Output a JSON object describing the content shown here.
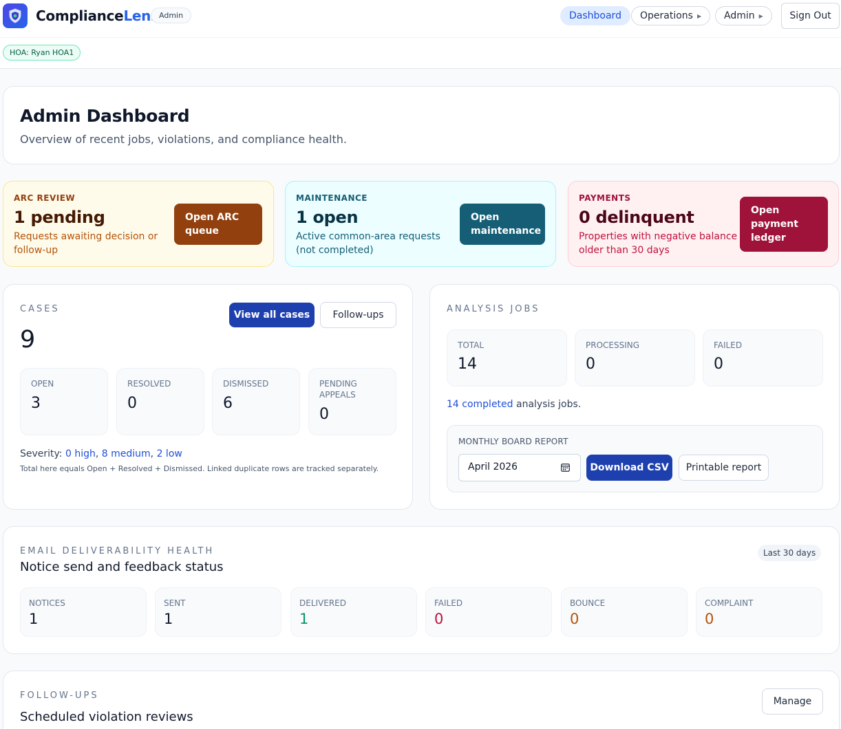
{
  "header": {
    "brand_main": "Compliance",
    "brand_accent": "Lens",
    "role": "Admin",
    "nav": {
      "dashboard": "Dashboard",
      "operations": "Operations",
      "admin": "Admin"
    },
    "sign_out": "Sign Out",
    "hoa": "HOA: Ryan HOA1"
  },
  "page": {
    "title": "Admin Dashboard",
    "subtitle": "Overview of recent jobs, violations, and compliance health."
  },
  "quick": {
    "arc": {
      "label": "ARC REVIEW",
      "value": "1 pending",
      "desc1": "Requests awaiting decision or",
      "desc2": "follow-up",
      "btn1": "Open ARC",
      "btn2": "queue"
    },
    "maintenance": {
      "label": "MAINTENANCE",
      "value": "1 open",
      "desc1": "Active common-area requests",
      "desc2": "(not completed)",
      "btn1": "Open",
      "btn2": "maintenance"
    },
    "payments": {
      "label": "PAYMENTS",
      "value": "0 delinquent",
      "desc1": "Properties with negative balance",
      "desc2": "older than 30 days",
      "btn1": "Open",
      "btn2": "payment",
      "btn3": "ledger"
    }
  },
  "cases": {
    "label": "CASES",
    "total": "9",
    "view_all": "View all cases",
    "follow_ups": "Follow-ups",
    "stats": [
      {
        "label": "OPEN",
        "value": "3"
      },
      {
        "label": "RESOLVED",
        "value": "0"
      },
      {
        "label": "DISMISSED",
        "value": "6"
      },
      {
        "label1": "PENDING",
        "label2": "APPEALS",
        "value": "0"
      }
    ],
    "severity_prefix": "Severity: ",
    "sev_high": "0 high",
    "sev_medium": "8 medium",
    "sev_low": "2 low",
    "sep": ", ",
    "note": "Total here equals Open + Resolved + Dismissed. Linked duplicate rows are tracked separately."
  },
  "jobs": {
    "label": "ANALYSIS JOBS",
    "stats": [
      {
        "label": "TOTAL",
        "value": "14"
      },
      {
        "label": "PROCESSING",
        "value": "0"
      },
      {
        "label": "FAILED",
        "value": "0"
      }
    ],
    "completed_link": "14 completed",
    "completed_suffix": " analysis jobs.",
    "report_label": "MONTHLY BOARD REPORT",
    "month": "April 2026",
    "download": "Download CSV",
    "printable": "Printable report"
  },
  "email": {
    "label": "EMAIL DELIVERABILITY HEALTH",
    "title": "Notice send and feedback status",
    "range": "Last 30 days",
    "stats": [
      {
        "label": "NOTICES",
        "value": "1"
      },
      {
        "label": "SENT",
        "value": "1"
      },
      {
        "label": "DELIVERED",
        "value": "1"
      },
      {
        "label": "FAILED",
        "value": "0"
      },
      {
        "label": "BOUNCE",
        "value": "0"
      },
      {
        "label": "COMPLAINT",
        "value": "0"
      }
    ]
  },
  "followups": {
    "label": "FOLLOW-UPS",
    "title": "Scheduled violation reviews",
    "manage": "Manage"
  },
  "colors": {
    "primary": "#1e40af",
    "arc": "#92400e",
    "maintenance": "#155e75",
    "payments": "#9f1239",
    "success": "#059669",
    "danger": "#be123c",
    "warning": "#b45309"
  }
}
